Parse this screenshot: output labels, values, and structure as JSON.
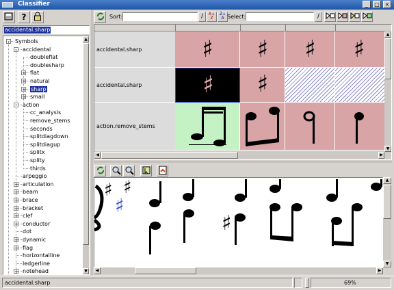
{
  "window": {
    "title": "Classifier"
  },
  "left": {
    "search_value": "accidental.sharp",
    "tree": [
      {
        "label": "Symbols",
        "depth": 0,
        "expander": "-"
      },
      {
        "label": "accidental",
        "depth": 1,
        "expander": "-"
      },
      {
        "label": "doubleflat",
        "depth": 2,
        "expander": ""
      },
      {
        "label": "doublesharp",
        "depth": 2,
        "expander": ""
      },
      {
        "label": "flat",
        "depth": 2,
        "expander": "+"
      },
      {
        "label": "natural",
        "depth": 2,
        "expander": "+"
      },
      {
        "label": "sharp",
        "depth": 2,
        "expander": "+",
        "selected": true
      },
      {
        "label": "small",
        "depth": 2,
        "expander": "+"
      },
      {
        "label": "action",
        "depth": 1,
        "expander": "-"
      },
      {
        "label": "cc_analysis",
        "depth": 2,
        "expander": ""
      },
      {
        "label": "remove_stems",
        "depth": 2,
        "expander": ""
      },
      {
        "label": "seconds",
        "depth": 2,
        "expander": ""
      },
      {
        "label": "splitdiagdown",
        "depth": 2,
        "expander": ""
      },
      {
        "label": "splitdiagup",
        "depth": 2,
        "expander": ""
      },
      {
        "label": "splitx",
        "depth": 2,
        "expander": ""
      },
      {
        "label": "splity",
        "depth": 2,
        "expander": ""
      },
      {
        "label": "thirds",
        "depth": 2,
        "expander": ""
      },
      {
        "label": "arpeggio",
        "depth": 1,
        "expander": ""
      },
      {
        "label": "articulation",
        "depth": 1,
        "expander": "+"
      },
      {
        "label": "beam",
        "depth": 1,
        "expander": "+"
      },
      {
        "label": "brace",
        "depth": 1,
        "expander": "+"
      },
      {
        "label": "bracket",
        "depth": 1,
        "expander": "+"
      },
      {
        "label": "clef",
        "depth": 1,
        "expander": "+"
      },
      {
        "label": "conductor",
        "depth": 1,
        "expander": "+"
      },
      {
        "label": "dot",
        "depth": 1,
        "expander": ""
      },
      {
        "label": "dynamic",
        "depth": 1,
        "expander": "+"
      },
      {
        "label": "flag",
        "depth": 1,
        "expander": "+"
      },
      {
        "label": "horizontalline",
        "depth": 1,
        "expander": ""
      },
      {
        "label": "ledgerline",
        "depth": 1,
        "expander": ""
      },
      {
        "label": "notehead",
        "depth": 1,
        "expander": "+"
      }
    ]
  },
  "toolbar": {
    "sort_label": "Sort:",
    "sort_value": "",
    "select_label": "Select:",
    "select_value": ""
  },
  "grid": {
    "rows": [
      {
        "label": "accidental.sharp"
      },
      {
        "label": "accidental.sharp"
      },
      {
        "label": "action.remove_stems"
      }
    ]
  },
  "statusbar": {
    "text": "accidental.sharp",
    "zoom": "69%"
  },
  "colors": {
    "pink": "#d9a4a6",
    "green": "#c5f2c5",
    "selected_black": "#000000",
    "selection_blue": "#1c2f9e"
  }
}
